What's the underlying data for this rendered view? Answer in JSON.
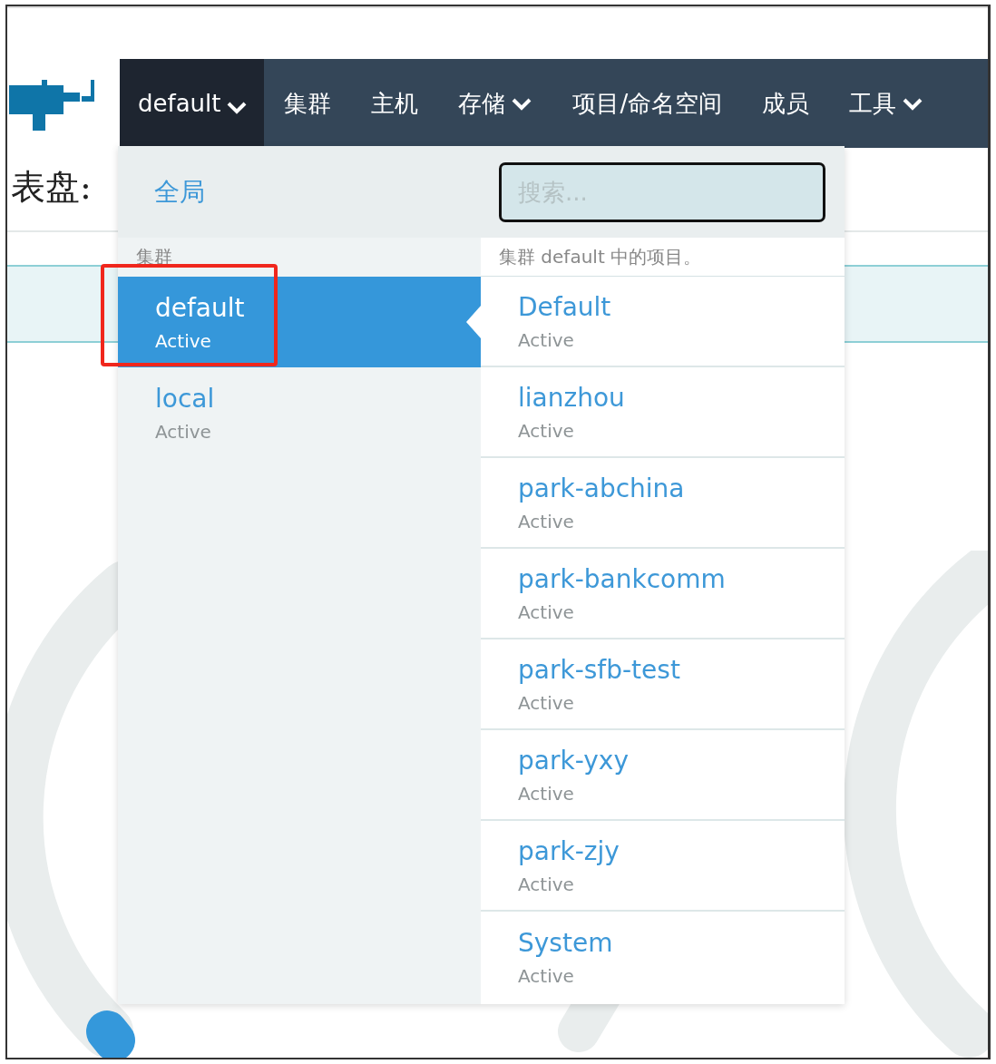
{
  "nav": {
    "cluster_switcher": {
      "label": "default",
      "expanded": true
    },
    "items": [
      {
        "label": "集群",
        "dropdown": false
      },
      {
        "label": "主机",
        "dropdown": false
      },
      {
        "label": "存储",
        "dropdown": true
      },
      {
        "label": "项目/命名空间",
        "dropdown": false
      },
      {
        "label": "成员",
        "dropdown": false
      },
      {
        "label": "工具",
        "dropdown": true
      }
    ]
  },
  "page": {
    "heading": "表盘:"
  },
  "dropdown": {
    "global_link": "全局",
    "clusters_heading": "集群",
    "clusters": [
      {
        "name": "default",
        "status": "Active",
        "selected": true
      },
      {
        "name": "local",
        "status": "Active",
        "selected": false
      }
    ],
    "search": {
      "placeholder": "搜索..."
    },
    "projects_heading": "集群 default 中的项目。",
    "projects": [
      {
        "name": "Default",
        "status": "Active"
      },
      {
        "name": "lianzhou",
        "status": "Active"
      },
      {
        "name": "park-abchina",
        "status": "Active"
      },
      {
        "name": "park-bankcomm",
        "status": "Active"
      },
      {
        "name": "park-sfb-test",
        "status": "Active"
      },
      {
        "name": "park-yxy",
        "status": "Active"
      },
      {
        "name": "park-zjy",
        "status": "Active"
      },
      {
        "name": "System",
        "status": "Active"
      }
    ]
  }
}
